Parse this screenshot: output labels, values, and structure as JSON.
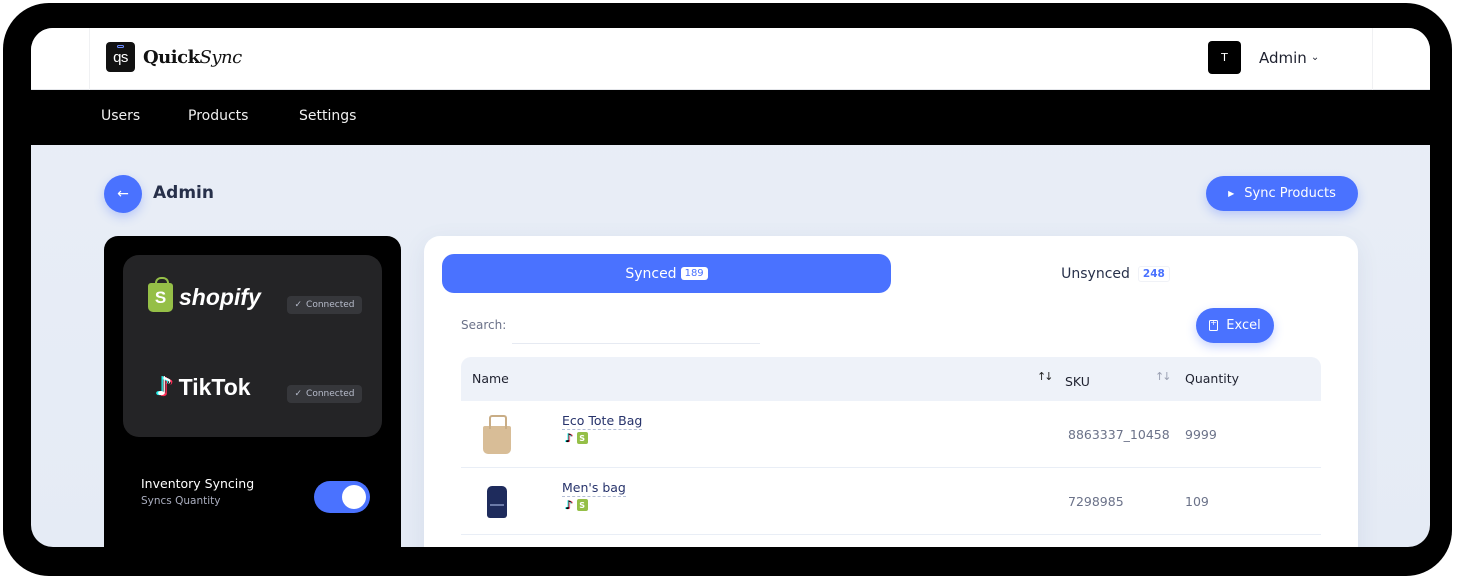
{
  "app": {
    "logo_mark": "qs",
    "logo_name_bold": "Quick",
    "logo_name_script": "Sync"
  },
  "user": {
    "avatar_initial": "T",
    "name": "Admin",
    "chevron_icon": "chevron-down-icon"
  },
  "nav": {
    "items": [
      {
        "label": "Users"
      },
      {
        "label": "Products"
      },
      {
        "label": "Settings"
      }
    ]
  },
  "page": {
    "back_icon": "arrow-left-icon",
    "title": "Admin",
    "sync_button": {
      "icon": "play-icon",
      "label": "Sync Products"
    }
  },
  "connections": {
    "platforms": [
      {
        "name": "shopify",
        "status": "Connected",
        "status_icon": "check-icon"
      },
      {
        "name": "TikTok",
        "status": "Connected",
        "status_icon": "check-icon"
      }
    ],
    "inventory": {
      "title": "Inventory Syncing",
      "subtitle": "Syncs Quantity",
      "enabled": true
    }
  },
  "products": {
    "tabs": [
      {
        "label": "Synced",
        "count": "189",
        "active": true
      },
      {
        "label": "Unsynced",
        "count": "248",
        "active": false
      }
    ],
    "search": {
      "label": "Search:",
      "value": "",
      "placeholder": ""
    },
    "excel_button": {
      "icon": "file-add-icon",
      "label": "Excel"
    },
    "columns": [
      {
        "label": "Name",
        "sortable": true
      },
      {
        "label": "SKU",
        "sortable": true
      },
      {
        "label": "Quantity",
        "sortable": false
      }
    ],
    "rows": [
      {
        "name": "Eco Tote Bag",
        "image": "tote-bag-image",
        "channels": [
          "tiktok",
          "shopify"
        ],
        "sku": "8863337_10458",
        "quantity": "9999"
      },
      {
        "name": "Men's bag",
        "image": "backpack-image",
        "channels": [
          "tiktok",
          "shopify"
        ],
        "sku": "7298985",
        "quantity": "109"
      }
    ]
  },
  "colors": {
    "accent": "#4a72ff",
    "shopify_green": "#95bf47",
    "nav_bg": "#000000",
    "page_bg": "#e9eef7"
  }
}
